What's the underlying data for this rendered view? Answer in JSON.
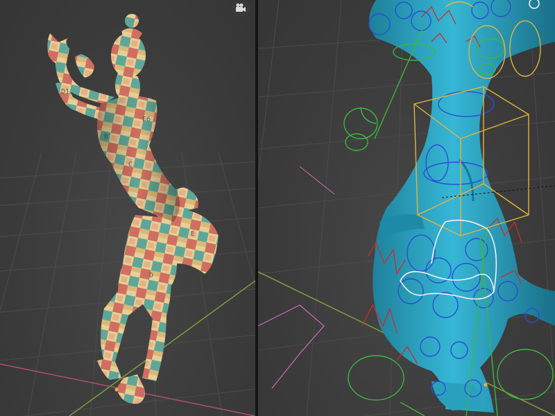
{
  "app": {
    "name": "3D Viewport"
  },
  "viewports": [
    {
      "id": "left",
      "shading": "textured",
      "object": "character-mesh",
      "overlays": {
        "camera_button": {
          "icon": "camera-icon"
        }
      }
    },
    {
      "id": "right",
      "shading": "solid-teal",
      "object": "character-mesh-closeup",
      "overlays": {
        "rig": true
      }
    }
  ],
  "colors": {
    "viewport_bg": "#3c3c3c",
    "grid": "#4a4a4a",
    "axis_x": "#b0506a",
    "axis_y": "#7aa03a",
    "mesh_solid": "#2aa8c8",
    "texture_cream": "#e6cf96",
    "texture_red": "#c84f4f",
    "texture_teal": "#3f9c98",
    "rig_blue": "#2a4fd0",
    "rig_red": "#d02a2a",
    "rig_green": "#3cb83c",
    "rig_yellow": "#e6b43a",
    "rig_white": "#f2f2f2",
    "rig_pink": "#c86eb4"
  }
}
